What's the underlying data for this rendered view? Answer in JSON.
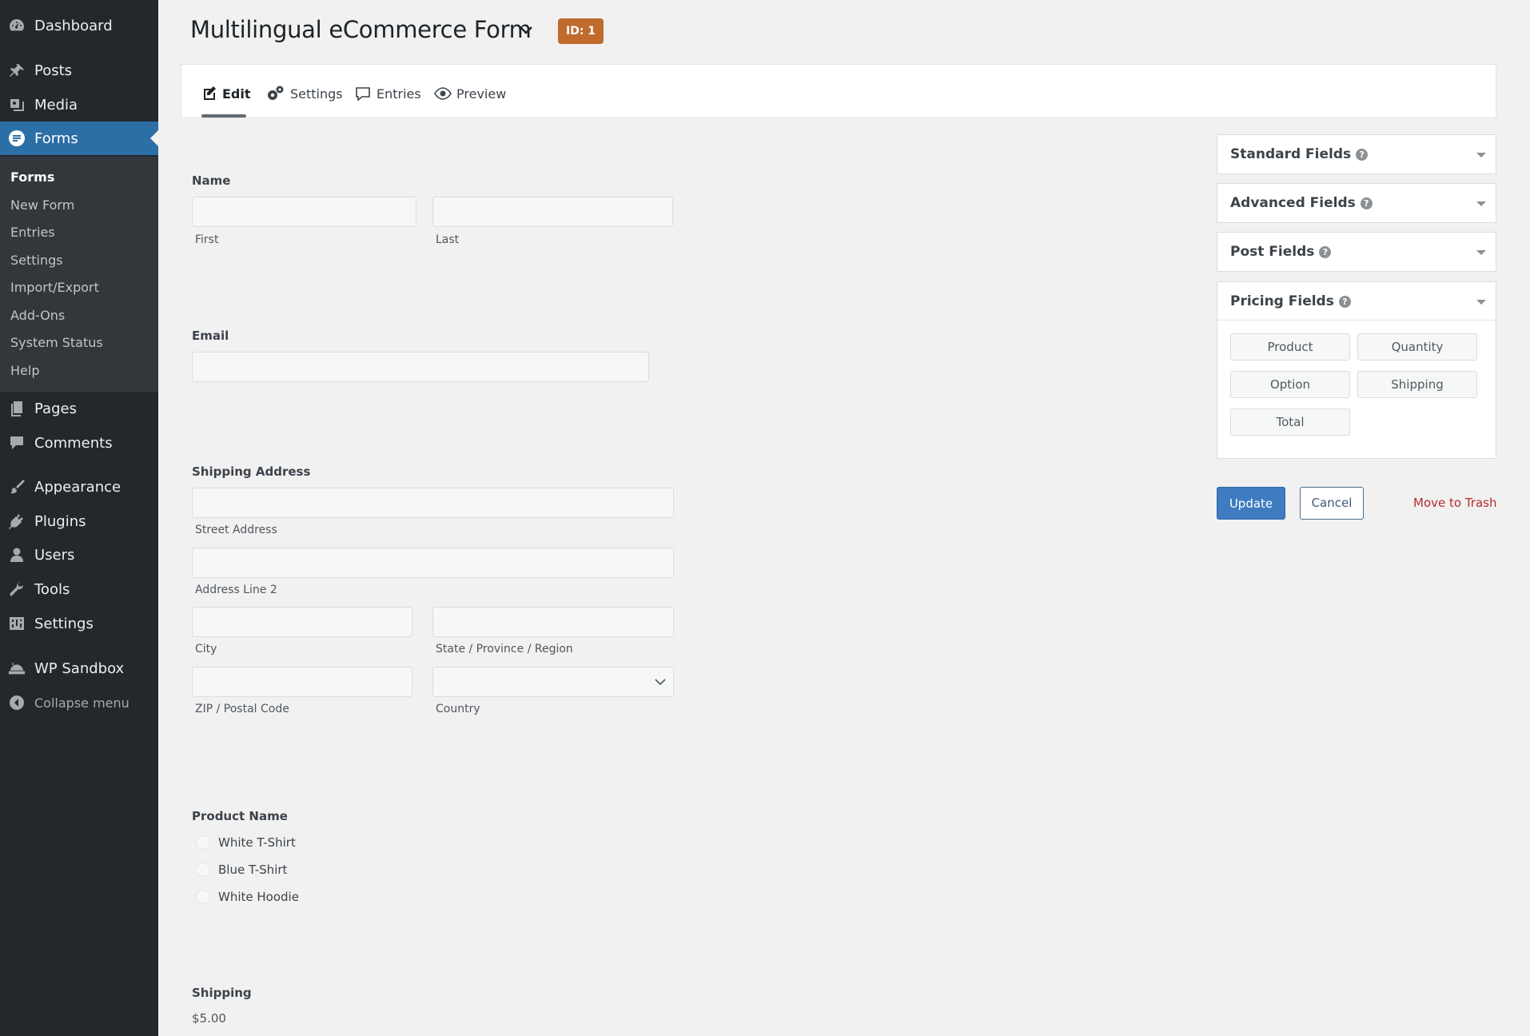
{
  "sidebar": {
    "items": [
      {
        "label": "Dashboard",
        "icon": "dashboard-icon"
      },
      {
        "label": "Posts",
        "icon": "pin-icon"
      },
      {
        "label": "Media",
        "icon": "media-icon"
      },
      {
        "label": "Forms",
        "icon": "forms-icon"
      },
      {
        "label": "Pages",
        "icon": "pages-icon"
      },
      {
        "label": "Comments",
        "icon": "comment-icon"
      },
      {
        "label": "Appearance",
        "icon": "brush-icon"
      },
      {
        "label": "Plugins",
        "icon": "plugin-icon"
      },
      {
        "label": "Users",
        "icon": "user-icon"
      },
      {
        "label": "Tools",
        "icon": "wrench-icon"
      },
      {
        "label": "Settings",
        "icon": "settings-icon"
      },
      {
        "label": "WP Sandbox",
        "icon": "sandbox-icon"
      }
    ],
    "submenu": [
      "Forms",
      "New Form",
      "Entries",
      "Settings",
      "Import/Export",
      "Add-Ons",
      "System Status",
      "Help"
    ],
    "collapse_label": "Collapse menu",
    "active_color": "#2c6ea6"
  },
  "header": {
    "title": "Multilingual eCommerce Form",
    "badge": "ID: 1",
    "badge_color": "#c06a2e"
  },
  "tabs": [
    {
      "label": "Edit",
      "icon": "edit-icon"
    },
    {
      "label": "Settings",
      "icon": "gears-icon"
    },
    {
      "label": "Entries",
      "icon": "comment-icon"
    },
    {
      "label": "Preview",
      "icon": "eye-icon"
    }
  ],
  "form": {
    "name": {
      "label": "Name",
      "first": "First",
      "last": "Last"
    },
    "email": {
      "label": "Email"
    },
    "address": {
      "label": "Shipping Address",
      "street": "Street Address",
      "line2": "Address Line 2",
      "city": "City",
      "state": "State / Province / Region",
      "zip": "ZIP / Postal Code",
      "country": "Country"
    },
    "product": {
      "label": "Product Name",
      "options": [
        "White T-Shirt",
        "Blue T-Shirt",
        "White Hoodie"
      ]
    },
    "shipping": {
      "label": "Shipping",
      "value": "$5.00"
    }
  },
  "panels": {
    "standard": "Standard Fields",
    "advanced": "Advanced Fields",
    "post": "Post Fields",
    "pricing": "Pricing Fields",
    "pricing_buttons": [
      "Product",
      "Quantity",
      "Option",
      "Shipping",
      "Total"
    ],
    "help_glyph": "?"
  },
  "actions": {
    "update": "Update",
    "cancel": "Cancel",
    "trash": "Move to Trash"
  }
}
